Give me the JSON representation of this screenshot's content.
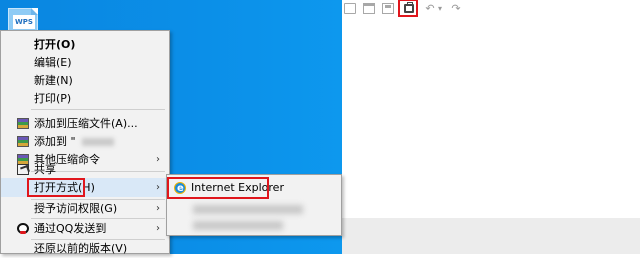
{
  "desktop": {
    "file_icon_label": "WPS"
  },
  "context_menu": {
    "items": [
      {
        "label": "打开(O)"
      },
      {
        "label": "编辑(E)"
      },
      {
        "label": "新建(N)"
      },
      {
        "label": "打印(P)"
      },
      {
        "label": "添加到压缩文件(A)..."
      },
      {
        "label": "添加到 \""
      },
      {
        "label": "其他压缩命令"
      },
      {
        "label": "共享"
      },
      {
        "label": "打开方式(H)"
      },
      {
        "label": "授予访问权限(G)"
      },
      {
        "label": "通过QQ发送到"
      },
      {
        "label": "还原以前的版本(V)"
      }
    ]
  },
  "open_with_submenu": {
    "items": [
      {
        "label": "Internet Explorer",
        "icon": "internet-explorer-icon"
      }
    ]
  },
  "toolbar": {
    "icons": [
      "new-doc-icon",
      "open-folder-icon",
      "save-icon",
      "print-icon",
      "undo-icon",
      "redo-icon"
    ]
  },
  "colors": {
    "highlight": "#e0161c",
    "desktop": "#0b8fe8",
    "menu_bg": "#f2f2f2"
  }
}
